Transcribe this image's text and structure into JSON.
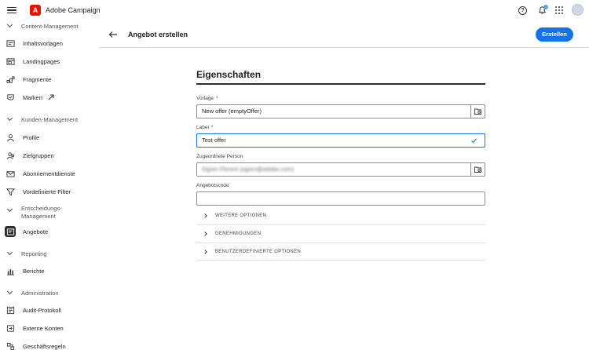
{
  "app": {
    "title": "Adobe Campaign",
    "logo_letter": "A"
  },
  "topbar": {
    "help_glyph": "?"
  },
  "sidebar": {
    "sections": [
      {
        "label": "Content-Management"
      },
      {
        "label": "Kunden-Management"
      },
      {
        "label_line1": "Entscheidungs-",
        "label_line2": "Management"
      },
      {
        "label": "Reporting"
      },
      {
        "label": "Administration"
      }
    ],
    "items": [
      {
        "label": "Inhaltsvorlagen",
        "icon": "template-icon"
      },
      {
        "label": "Landingpages",
        "icon": "landingpage-icon"
      },
      {
        "label": "Fragmente",
        "icon": "fragment-icon"
      },
      {
        "label": "Marken",
        "icon": "brand-icon"
      },
      {
        "label": "Profile",
        "icon": "profile-icon"
      },
      {
        "label": "Zielgruppen",
        "icon": "audience-icon"
      },
      {
        "label": "Abonnementdienste",
        "icon": "subscription-icon"
      },
      {
        "label": "Vordefinierte Filter",
        "icon": "filter-icon"
      },
      {
        "label": "Angebote",
        "icon": "offer-icon",
        "active": true
      },
      {
        "label": "Berichte",
        "icon": "report-icon"
      },
      {
        "label": "Audit-Protokoll",
        "icon": "audit-icon"
      },
      {
        "label": "Externe Konten",
        "icon": "account-icon"
      },
      {
        "label": "Geschäftsregeln",
        "icon": "rules-icon"
      }
    ]
  },
  "header": {
    "title": "Angebot erstellen",
    "create_label": "Erstellen"
  },
  "form": {
    "section_title": "Eigenschaften",
    "vorlage": {
      "label": "Vorlage",
      "required": "*",
      "value": "New offer (emptyOffer)"
    },
    "label": {
      "label": "Label",
      "required": "*",
      "value": "Test offer"
    },
    "person": {
      "label": "Zugeordnete Person",
      "value": "Ogren Florent (ogren@adobe.com)"
    },
    "code": {
      "label": "Angebotscode",
      "value": ""
    },
    "accordions": [
      {
        "label": "WEITERE OPTIONEN"
      },
      {
        "label": "GENEHMIGUNGEN"
      },
      {
        "label": "BENUTZERDEFINIERTE OPTIONEN"
      }
    ]
  },
  "colors": {
    "accent": "#1473e6",
    "brand": "#eb1000",
    "valid": "#2d9d78"
  }
}
